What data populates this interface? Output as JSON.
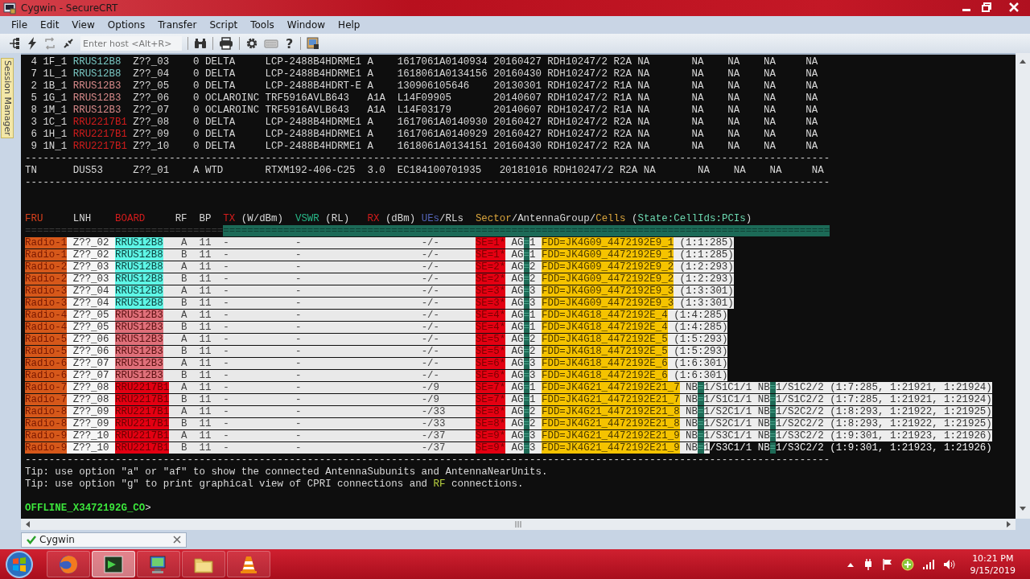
{
  "window": {
    "title": "Cygwin - SecureCRT"
  },
  "menu": [
    "File",
    "Edit",
    "View",
    "Options",
    "Transfer",
    "Script",
    "Tools",
    "Window",
    "Help"
  ],
  "toolbar": {
    "host_field": {
      "placeholder": "Enter host <Alt+R>"
    },
    "help_button": "?"
  },
  "session_manager": {
    "label": "Session Manager"
  },
  "terminal": {
    "lines": [
      {
        "kind": "text",
        "segments": [
          {
            "text": " 4 1F_1 ",
            "kind": "plain"
          },
          {
            "text": "RRUS12B8",
            "kind": "fg-cyan"
          },
          {
            "text": "  Z??_03    0 DELTA     LCP-2488B4HDRME1 A    1617061A0140934 20160427 RDH10247/2 R2A NA       NA    NA    NA     NA",
            "kind": "plain"
          }
        ]
      },
      {
        "kind": "text",
        "segments": [
          {
            "text": " 7 1L_1 ",
            "kind": "plain"
          },
          {
            "text": "RRUS12B8",
            "kind": "fg-cyan"
          },
          {
            "text": "  Z??_04    0 DELTA     LCP-2488B4HDRME1 A    1618061A0134156 20160430 RDH10247/2 R2A NA       NA    NA    NA     NA",
            "kind": "plain"
          }
        ]
      },
      {
        "kind": "text",
        "segments": [
          {
            "text": " 2 1B_1 ",
            "kind": "plain"
          },
          {
            "text": "RRUS12B3",
            "kind": "fg-pink"
          },
          {
            "text": "  Z??_05    0 DELTA     LCP-2488B4HDRT-E A    130906105646    20130301 RDH10247/2 R1A NA       NA    NA    NA     NA",
            "kind": "plain"
          }
        ]
      },
      {
        "kind": "text",
        "segments": [
          {
            "text": " 5 1G_1 ",
            "kind": "plain"
          },
          {
            "text": "RRUS12B3",
            "kind": "fg-pink"
          },
          {
            "text": "  Z??_06    0 OCLAROINC TRF5916AVLB643   A1A  L14F09905       20140607 RDH10247/2 R1A NA       NA    NA    NA     NA",
            "kind": "plain"
          }
        ]
      },
      {
        "kind": "text",
        "segments": [
          {
            "text": " 8 1M_1 ",
            "kind": "plain"
          },
          {
            "text": "RRUS12B3",
            "kind": "fg-pink"
          },
          {
            "text": "  Z??_07    0 OCLAROINC TRF5916AVLB643   A1A  L14F03179       20140607 RDH10247/2 R1A NA       NA    NA    NA     NA",
            "kind": "plain"
          }
        ]
      },
      {
        "kind": "text",
        "segments": [
          {
            "text": " 3 1C_1 ",
            "kind": "plain"
          },
          {
            "text": "RRU2217B1",
            "kind": "fg-red"
          },
          {
            "text": " Z??_08    0 DELTA     LCP-2488B4HDRME1 A    1617061A0140930 20160427 RDH10247/2 R2A NA       NA    NA    NA     NA",
            "kind": "plain"
          }
        ]
      },
      {
        "kind": "text",
        "segments": [
          {
            "text": " 6 1H_1 ",
            "kind": "plain"
          },
          {
            "text": "RRU2217B1",
            "kind": "fg-red"
          },
          {
            "text": " Z??_09    0 DELTA     LCP-2488B4HDRME1 A    1617061A0140929 20160427 RDH10247/2 R2A NA       NA    NA    NA     NA",
            "kind": "plain"
          }
        ]
      },
      {
        "kind": "text",
        "segments": [
          {
            "text": " 9 1N_1 ",
            "kind": "plain"
          },
          {
            "text": "RRU2217B1",
            "kind": "fg-red"
          },
          {
            "text": " Z??_10    0 DELTA     LCP-2488B4HDRME1 A    1618061A0134151 20160430 RDH10247/2 R2A NA       NA    NA    NA     NA",
            "kind": "plain"
          }
        ]
      },
      {
        "kind": "text",
        "segments": [
          {
            "text": "--------------------------------------------------------------------------------------------------------------------------------------",
            "kind": "plain"
          }
        ]
      },
      {
        "kind": "text",
        "segments": [
          {
            "text": "TN      DUS53     Z??_01    A WTD       RTXM192-406-C25  3.0  EC184100701935   20181016 RDH10247/2 R2A NA       NA    NA    NA     NA",
            "kind": "plain"
          }
        ]
      },
      {
        "kind": "text",
        "segments": [
          {
            "text": "--------------------------------------------------------------------------------------------------------------------------------------",
            "kind": "plain"
          }
        ]
      },
      {
        "kind": "blank"
      },
      {
        "kind": "blank"
      },
      {
        "kind": "text",
        "segments": [
          {
            "text": "FRU",
            "kind": "fg-orange"
          },
          {
            "text": "     LNH    ",
            "kind": "plain"
          },
          {
            "text": "BOARD",
            "kind": "fg-red"
          },
          {
            "text": "     RF  BP  ",
            "kind": "plain"
          },
          {
            "text": "TX",
            "kind": "fg-red"
          },
          {
            "text": " (W/dBm)  ",
            "kind": "plain"
          },
          {
            "text": "VSWR",
            "kind": "fg-green"
          },
          {
            "text": " (RL)   ",
            "kind": "plain"
          },
          {
            "text": "RX",
            "kind": "fg-red"
          },
          {
            "text": " (dBm) ",
            "kind": "plain"
          },
          {
            "text": "UEs",
            "kind": "fg-blue"
          },
          {
            "text": "/RLs  ",
            "kind": "plain"
          },
          {
            "text": "Sector",
            "kind": "fg-gold"
          },
          {
            "text": "/AntennaGroup/",
            "kind": "plain"
          },
          {
            "text": "Cells",
            "kind": "fg-gold"
          },
          {
            "text": " (",
            "kind": "plain"
          },
          {
            "text": "State:CellIds:PCIs",
            "kind": "fg-teal"
          },
          {
            "text": ")",
            "kind": "plain"
          }
        ]
      },
      {
        "kind": "text",
        "segments": [
          {
            "text": "=================================",
            "kind": "dim"
          },
          {
            "text": "=====================================================================================================",
            "kind": "teal-rule"
          }
        ]
      },
      {
        "kind": "text",
        "segments": [
          {
            "text": "Radio-1",
            "kind": "cell-orange"
          },
          {
            "text": " Z??_02 ",
            "kind": "cell-white"
          },
          {
            "text": "RRUS12B8",
            "kind": "cell-cyan"
          },
          {
            "text": "   A  11  -           -                    -/-      ",
            "kind": "cell-grey"
          },
          {
            "text": "SE=1*",
            "kind": "cell-se"
          },
          {
            "text": " AG",
            "kind": "cell-light"
          },
          {
            "text": "=",
            "kind": "cell-teal"
          },
          {
            "text": "1 ",
            "kind": "cell-light"
          },
          {
            "text": "FDD=JK4G09_4472192E9_1",
            "kind": "cell-yellow"
          },
          {
            "text": " (1:1:285)",
            "kind": "cell-light"
          }
        ]
      },
      {
        "kind": "text",
        "segments": [
          {
            "text": "Radio-1",
            "kind": "cell-orange"
          },
          {
            "text": " Z??_02 ",
            "kind": "cell-white"
          },
          {
            "text": "RRUS12B8",
            "kind": "cell-cyan"
          },
          {
            "text": "   B  11  -           -                    -/-      ",
            "kind": "cell-grey"
          },
          {
            "text": "SE=1*",
            "kind": "cell-se"
          },
          {
            "text": " AG",
            "kind": "cell-light"
          },
          {
            "text": "=",
            "kind": "cell-teal"
          },
          {
            "text": "1 ",
            "kind": "cell-light"
          },
          {
            "text": "FDD=JK4G09_4472192E9_1",
            "kind": "cell-yellow"
          },
          {
            "text": " (1:1:285)",
            "kind": "cell-light"
          }
        ]
      },
      {
        "kind": "text",
        "segments": [
          {
            "text": "Radio-2",
            "kind": "cell-orange"
          },
          {
            "text": " Z??_03 ",
            "kind": "cell-white"
          },
          {
            "text": "RRUS12B8",
            "kind": "cell-cyan"
          },
          {
            "text": "   A  11  -           -                    -/-      ",
            "kind": "cell-grey"
          },
          {
            "text": "SE=2*",
            "kind": "cell-se"
          },
          {
            "text": " AG",
            "kind": "cell-light"
          },
          {
            "text": "=",
            "kind": "cell-teal"
          },
          {
            "text": "2 ",
            "kind": "cell-light"
          },
          {
            "text": "FDD=JK4G09_4472192E9_2",
            "kind": "cell-yellow"
          },
          {
            "text": " (1:2:293)",
            "kind": "cell-light"
          }
        ]
      },
      {
        "kind": "text",
        "segments": [
          {
            "text": "Radio-2",
            "kind": "cell-orange"
          },
          {
            "text": " Z??_03 ",
            "kind": "cell-white"
          },
          {
            "text": "RRUS12B8",
            "kind": "cell-cyan"
          },
          {
            "text": "   B  11  -           -                    -/-      ",
            "kind": "cell-grey"
          },
          {
            "text": "SE=2*",
            "kind": "cell-se"
          },
          {
            "text": " AG",
            "kind": "cell-light"
          },
          {
            "text": "=",
            "kind": "cell-teal"
          },
          {
            "text": "2 ",
            "kind": "cell-light"
          },
          {
            "text": "FDD=JK4G09_4472192E9_2",
            "kind": "cell-yellow"
          },
          {
            "text": " (1:2:293)",
            "kind": "cell-light"
          }
        ]
      },
      {
        "kind": "text",
        "segments": [
          {
            "text": "Radio-3",
            "kind": "cell-orange"
          },
          {
            "text": " Z??_04 ",
            "kind": "cell-white"
          },
          {
            "text": "RRUS12B8",
            "kind": "cell-cyan"
          },
          {
            "text": "   A  11  -           -                    -/-      ",
            "kind": "cell-grey"
          },
          {
            "text": "SE=3*",
            "kind": "cell-se"
          },
          {
            "text": " AG",
            "kind": "cell-light"
          },
          {
            "text": "=",
            "kind": "cell-teal"
          },
          {
            "text": "3 ",
            "kind": "cell-light"
          },
          {
            "text": "FDD=JK4G09_4472192E9_3",
            "kind": "cell-yellow"
          },
          {
            "text": " (1:3:301)",
            "kind": "cell-light"
          }
        ]
      },
      {
        "kind": "text",
        "segments": [
          {
            "text": "Radio-3",
            "kind": "cell-orange"
          },
          {
            "text": " Z??_04 ",
            "kind": "cell-white"
          },
          {
            "text": "RRUS12B8",
            "kind": "cell-cyan"
          },
          {
            "text": "   B  11  -           -                    -/-      ",
            "kind": "cell-grey"
          },
          {
            "text": "SE=3*",
            "kind": "cell-se"
          },
          {
            "text": " AG",
            "kind": "cell-light"
          },
          {
            "text": "=",
            "kind": "cell-teal"
          },
          {
            "text": "3 ",
            "kind": "cell-light"
          },
          {
            "text": "FDD=JK4G09_4472192E9_3",
            "kind": "cell-yellow"
          },
          {
            "text": " (1:3:301)",
            "kind": "cell-light"
          }
        ]
      },
      {
        "kind": "text",
        "segments": [
          {
            "text": "Radio-4",
            "kind": "cell-orange"
          },
          {
            "text": " Z??_05 ",
            "kind": "cell-white"
          },
          {
            "text": "RRUS12B3",
            "kind": "cell-pink"
          },
          {
            "text": "   A  11  -           -                    -/-      ",
            "kind": "cell-grey"
          },
          {
            "text": "SE=4*",
            "kind": "cell-se"
          },
          {
            "text": " AG",
            "kind": "cell-light"
          },
          {
            "text": "=",
            "kind": "cell-teal"
          },
          {
            "text": "1 ",
            "kind": "cell-light"
          },
          {
            "text": "FDD=JK4G18_4472192E_4",
            "kind": "cell-yellow"
          },
          {
            "text": " (1:4:285)",
            "kind": "cell-light"
          }
        ]
      },
      {
        "kind": "text",
        "segments": [
          {
            "text": "Radio-4",
            "kind": "cell-orange"
          },
          {
            "text": " Z??_05 ",
            "kind": "cell-white"
          },
          {
            "text": "RRUS12B3",
            "kind": "cell-pink"
          },
          {
            "text": "   B  11  -           -                    -/-      ",
            "kind": "cell-grey"
          },
          {
            "text": "SE=4*",
            "kind": "cell-se"
          },
          {
            "text": " AG",
            "kind": "cell-light"
          },
          {
            "text": "=",
            "kind": "cell-teal"
          },
          {
            "text": "1 ",
            "kind": "cell-light"
          },
          {
            "text": "FDD=JK4G18_4472192E_4",
            "kind": "cell-yellow"
          },
          {
            "text": " (1:4:285)",
            "kind": "cell-light"
          }
        ]
      },
      {
        "kind": "text",
        "segments": [
          {
            "text": "Radio-5",
            "kind": "cell-orange"
          },
          {
            "text": " Z??_06 ",
            "kind": "cell-white"
          },
          {
            "text": "RRUS12B3",
            "kind": "cell-pink"
          },
          {
            "text": "   A  11  -           -                    -/-      ",
            "kind": "cell-grey"
          },
          {
            "text": "SE=5*",
            "kind": "cell-se"
          },
          {
            "text": " AG",
            "kind": "cell-light"
          },
          {
            "text": "=",
            "kind": "cell-teal"
          },
          {
            "text": "2 ",
            "kind": "cell-light"
          },
          {
            "text": "FDD=JK4G18_4472192E_5",
            "kind": "cell-yellow"
          },
          {
            "text": " (1:5:293)",
            "kind": "cell-light"
          }
        ]
      },
      {
        "kind": "text",
        "segments": [
          {
            "text": "Radio-5",
            "kind": "cell-orange"
          },
          {
            "text": " Z??_06 ",
            "kind": "cell-white"
          },
          {
            "text": "RRUS12B3",
            "kind": "cell-pink"
          },
          {
            "text": "   B  11  -           -                    -/-      ",
            "kind": "cell-grey"
          },
          {
            "text": "SE=5*",
            "kind": "cell-se"
          },
          {
            "text": " AG",
            "kind": "cell-light"
          },
          {
            "text": "=",
            "kind": "cell-teal"
          },
          {
            "text": "2 ",
            "kind": "cell-light"
          },
          {
            "text": "FDD=JK4G18_4472192E_5",
            "kind": "cell-yellow"
          },
          {
            "text": " (1:5:293)",
            "kind": "cell-light"
          }
        ]
      },
      {
        "kind": "text",
        "segments": [
          {
            "text": "Radio-6",
            "kind": "cell-orange"
          },
          {
            "text": " Z??_07 ",
            "kind": "cell-white"
          },
          {
            "text": "RRUS12B3",
            "kind": "cell-pink"
          },
          {
            "text": "   A  11  -           -                    -/-      ",
            "kind": "cell-grey"
          },
          {
            "text": "SE=6*",
            "kind": "cell-se"
          },
          {
            "text": " AG",
            "kind": "cell-light"
          },
          {
            "text": "=",
            "kind": "cell-teal"
          },
          {
            "text": "3 ",
            "kind": "cell-light"
          },
          {
            "text": "FDD=JK4G18_4472192E_6",
            "kind": "cell-yellow"
          },
          {
            "text": " (1:6:301)",
            "kind": "cell-light"
          }
        ]
      },
      {
        "kind": "text",
        "segments": [
          {
            "text": "Radio-6",
            "kind": "cell-orange"
          },
          {
            "text": " Z??_07 ",
            "kind": "cell-white"
          },
          {
            "text": "RRUS12B3",
            "kind": "cell-pink"
          },
          {
            "text": "   B  11  -           -                    -/-      ",
            "kind": "cell-grey"
          },
          {
            "text": "SE=6*",
            "kind": "cell-se"
          },
          {
            "text": " AG",
            "kind": "cell-light"
          },
          {
            "text": "=",
            "kind": "cell-teal"
          },
          {
            "text": "3 ",
            "kind": "cell-light"
          },
          {
            "text": "FDD=JK4G18_4472192E_6",
            "kind": "cell-yellow"
          },
          {
            "text": " (1:6:301)",
            "kind": "cell-light"
          }
        ]
      },
      {
        "kind": "text",
        "segments": [
          {
            "text": "Radio-7",
            "kind": "cell-orange"
          },
          {
            "text": " Z??_08 ",
            "kind": "cell-white"
          },
          {
            "text": "RRU2217B1",
            "kind": "cell-red"
          },
          {
            "text": "  A  11  -           -                    -/9      ",
            "kind": "cell-grey"
          },
          {
            "text": "SE=7*",
            "kind": "cell-se"
          },
          {
            "text": " AG",
            "kind": "cell-light"
          },
          {
            "text": "=",
            "kind": "cell-teal"
          },
          {
            "text": "1 ",
            "kind": "cell-light"
          },
          {
            "text": "FDD=JK4G21_4472192E21_7",
            "kind": "cell-yellow"
          },
          {
            "text": " NB",
            "kind": "cell-light"
          },
          {
            "text": "=",
            "kind": "cell-teal"
          },
          {
            "text": "1/S1C1/1 NB",
            "kind": "cell-light"
          },
          {
            "text": "=",
            "kind": "cell-teal"
          },
          {
            "text": "1/S1C2/2 (1:7:285, 1:21921, 1:21924)",
            "kind": "cell-light"
          }
        ]
      },
      {
        "kind": "text",
        "segments": [
          {
            "text": "Radio-7",
            "kind": "cell-orange"
          },
          {
            "text": " Z??_08 ",
            "kind": "cell-white"
          },
          {
            "text": "RRU2217B1",
            "kind": "cell-red"
          },
          {
            "text": "  B  11  -           -                    -/9      ",
            "kind": "cell-grey"
          },
          {
            "text": "SE=7*",
            "kind": "cell-se"
          },
          {
            "text": " AG",
            "kind": "cell-light"
          },
          {
            "text": "=",
            "kind": "cell-teal"
          },
          {
            "text": "1 ",
            "kind": "cell-light"
          },
          {
            "text": "FDD=JK4G21_4472192E21_7",
            "kind": "cell-yellow"
          },
          {
            "text": " NB",
            "kind": "cell-light"
          },
          {
            "text": "=",
            "kind": "cell-teal"
          },
          {
            "text": "1/S1C1/1 NB",
            "kind": "cell-light"
          },
          {
            "text": "=",
            "kind": "cell-teal"
          },
          {
            "text": "1/S1C2/2 (1:7:285, 1:21921, 1:21924)",
            "kind": "cell-light"
          }
        ]
      },
      {
        "kind": "text",
        "segments": [
          {
            "text": "Radio-8",
            "kind": "cell-orange"
          },
          {
            "text": " Z??_09 ",
            "kind": "cell-white"
          },
          {
            "text": "RRU2217B1",
            "kind": "cell-red"
          },
          {
            "text": "  A  11  -           -                    -/33     ",
            "kind": "cell-grey"
          },
          {
            "text": "SE=8*",
            "kind": "cell-se"
          },
          {
            "text": " AG",
            "kind": "cell-light"
          },
          {
            "text": "=",
            "kind": "cell-teal"
          },
          {
            "text": "2 ",
            "kind": "cell-light"
          },
          {
            "text": "FDD=JK4G21_4472192E21_8",
            "kind": "cell-yellow"
          },
          {
            "text": " NB",
            "kind": "cell-light"
          },
          {
            "text": "=",
            "kind": "cell-teal"
          },
          {
            "text": "1/S2C1/1 NB",
            "kind": "cell-light"
          },
          {
            "text": "=",
            "kind": "cell-teal"
          },
          {
            "text": "1/S2C2/2 (1:8:293, 1:21922, 1:21925)",
            "kind": "cell-light"
          }
        ]
      },
      {
        "kind": "text",
        "segments": [
          {
            "text": "Radio-8",
            "kind": "cell-orange"
          },
          {
            "text": " Z??_09 ",
            "kind": "cell-white"
          },
          {
            "text": "RRU2217B1",
            "kind": "cell-red"
          },
          {
            "text": "  B  11  -           -                    -/33     ",
            "kind": "cell-grey"
          },
          {
            "text": "SE=8*",
            "kind": "cell-se"
          },
          {
            "text": " AG",
            "kind": "cell-light"
          },
          {
            "text": "=",
            "kind": "cell-teal"
          },
          {
            "text": "2 ",
            "kind": "cell-light"
          },
          {
            "text": "FDD=JK4G21_4472192E21_8",
            "kind": "cell-yellow"
          },
          {
            "text": " NB",
            "kind": "cell-light"
          },
          {
            "text": "=",
            "kind": "cell-teal"
          },
          {
            "text": "1/S2C1/1 NB",
            "kind": "cell-light"
          },
          {
            "text": "=",
            "kind": "cell-teal"
          },
          {
            "text": "1/S2C2/2 (1:8:293, 1:21922, 1:21925)",
            "kind": "cell-light"
          }
        ]
      },
      {
        "kind": "text",
        "segments": [
          {
            "text": "Radio-9",
            "kind": "cell-orange"
          },
          {
            "text": " Z??_10 ",
            "kind": "cell-white"
          },
          {
            "text": "RRU2217B1",
            "kind": "cell-red"
          },
          {
            "text": "  A  11  -           -                    -/37     ",
            "kind": "cell-grey"
          },
          {
            "text": "SE=9*",
            "kind": "cell-se"
          },
          {
            "text": " AG",
            "kind": "cell-light"
          },
          {
            "text": "=",
            "kind": "cell-teal"
          },
          {
            "text": "3 ",
            "kind": "cell-light"
          },
          {
            "text": "FDD=JK4G21_4472192E21_9",
            "kind": "cell-yellow"
          },
          {
            "text": " NB",
            "kind": "cell-light"
          },
          {
            "text": "=",
            "kind": "cell-teal"
          },
          {
            "text": "1/S3C1/1 NB",
            "kind": "cell-light"
          },
          {
            "text": "=",
            "kind": "cell-teal"
          },
          {
            "text": "1/S3C2/2 (1:9:301, 1:21923, 1:21926)",
            "kind": "cell-light"
          }
        ]
      },
      {
        "kind": "text",
        "segments": [
          {
            "text": "Radio-9",
            "kind": "cell-orange"
          },
          {
            "text": " Z??_10 ",
            "kind": "cell-white"
          },
          {
            "text": "RRU2217B1",
            "kind": "cell-red"
          },
          {
            "text": "  B  11  -           -                    -/37     ",
            "kind": "cell-grey"
          },
          {
            "text": "SE=9*",
            "kind": "cell-se"
          },
          {
            "text": " AG",
            "kind": "cell-light"
          },
          {
            "text": "=",
            "kind": "cell-teal"
          },
          {
            "text": "3 ",
            "kind": "cell-light"
          },
          {
            "text": "FDD=JK4G21_4472192E21_9",
            "kind": "cell-yellow"
          },
          {
            "text": " NB",
            "kind": "cell-light"
          },
          {
            "text": "=",
            "kind": "cell-teal"
          },
          {
            "text": "1",
            "kind": "cell-light"
          },
          {
            "text": "/S3C1/1 NB",
            "kind": "bright"
          },
          {
            "text": "=",
            "kind": "cell-teal"
          },
          {
            "text": "1/S3C2/2 (1:9:301, 1:21923, 1:21926)",
            "kind": "bright"
          }
        ]
      },
      {
        "kind": "text",
        "segments": [
          {
            "text": "--------------------------------------------------------------------------------------------------------------------------------------",
            "kind": "plain"
          }
        ]
      },
      {
        "kind": "text",
        "segments": [
          {
            "text": "Tip: use option \"a\" or \"af\" to show the connected AntennaSubunits and AntennaNearUnits.",
            "kind": "plain"
          }
        ]
      },
      {
        "kind": "text",
        "segments": [
          {
            "text": "Tip: use option \"g\" to print graphical view of CPRI connections and ",
            "kind": "plain"
          },
          {
            "text": "RF",
            "kind": "fg-lime"
          },
          {
            "text": " connections.",
            "kind": "plain"
          }
        ]
      },
      {
        "kind": "blank"
      },
      {
        "kind": "text",
        "segments": [
          {
            "text": "OFFLINE_X3472192G_CO",
            "kind": "prompt"
          },
          {
            "text": ">",
            "kind": "plain"
          }
        ]
      }
    ]
  },
  "tabs": [
    {
      "label": "Cygwin",
      "selected": true
    }
  ],
  "taskbar": {
    "apps": [
      {
        "kind": "browser",
        "selected": false
      },
      {
        "kind": "terminal",
        "selected": true
      },
      {
        "kind": "monitor",
        "selected": false
      },
      {
        "kind": "folder",
        "selected": false
      },
      {
        "kind": "cone",
        "selected": false
      }
    ],
    "time": "10:21 PM",
    "date": "9/15/2019"
  }
}
